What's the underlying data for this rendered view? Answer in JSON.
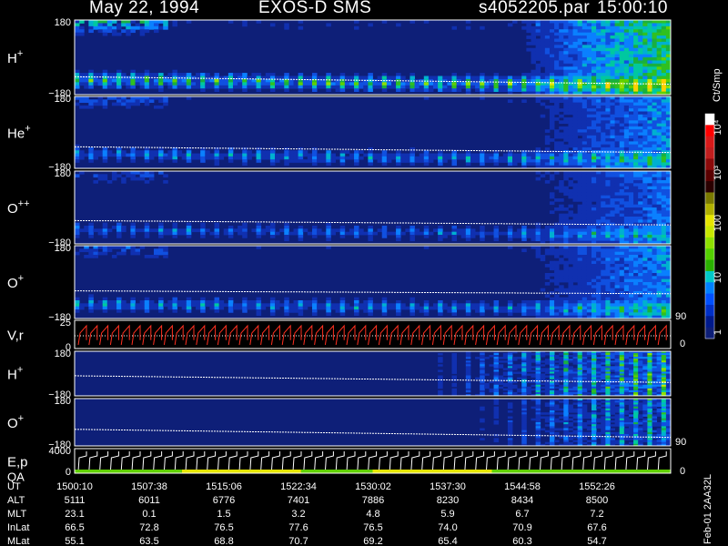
{
  "header": {
    "date": "May 22, 1994",
    "mission": "EXOS-D SMS",
    "file": "s4052205.par",
    "time": "15:00:10"
  },
  "colorbar": {
    "unit_label": "Ct/Smp",
    "tick_labels": [
      "10⁴",
      "10³",
      "100",
      "10",
      "1"
    ],
    "colors": [
      "#ffffff",
      "#ff0000",
      "#d81a1a",
      "#c01e1e",
      "#8b0a0a",
      "#5a0000",
      "#2a0000",
      "#7a7a00",
      "#b0b000",
      "#e6e600",
      "#c8e800",
      "#8ee000",
      "#54d000",
      "#2ab000",
      "#00c8c8",
      "#0080ff",
      "#0050ff",
      "#0030c8",
      "#001a8c",
      "#0e1f78"
    ]
  },
  "side_labels": {
    "colorbar_90_top": "90",
    "colorbar_0_top": "0",
    "colorbar_90_bot": "90",
    "colorbar_0_bot": "0"
  },
  "footer_id": "Feb-01 2AA32L",
  "chart_data": {
    "type": "heatmap",
    "title": "May 22, 1994   EXOS-D SMS   s4052205.par  15:00:10",
    "panels": [
      {
        "label_main": "H",
        "label_sup": "+",
        "ytop": "180",
        "ybot": "−180",
        "pattern": "ion",
        "intensity": 1.0,
        "trace": [
          0.76,
          0.86
        ],
        "late_shift": 0.0
      },
      {
        "label_main": "He",
        "label_sup": "+",
        "ytop": "180",
        "ybot": "−180",
        "pattern": "ion",
        "intensity": 0.55,
        "trace": [
          0.7,
          0.78
        ],
        "late_shift": 0.0
      },
      {
        "label_main": "O",
        "label_sup": "++",
        "ytop": "180",
        "ybot": "−180",
        "pattern": "ion",
        "intensity": 0.45,
        "trace": [
          0.68,
          0.74
        ],
        "late_shift": 0.0
      },
      {
        "label_main": "O",
        "label_sup": "+",
        "ytop": "180",
        "ybot": "−180",
        "pattern": "ion",
        "intensity": 0.55,
        "trace": [
          0.62,
          0.66
        ],
        "late_shift": 0.0
      },
      {
        "label_main": "V,r",
        "label_sup": "",
        "ytop": "25",
        "ybot": "0",
        "pattern": "sawtooth",
        "intensity": 0,
        "trace": [
          0.5,
          0.5
        ],
        "late_shift": 0
      },
      {
        "label_main": "H",
        "label_sup": "+",
        "ytop": "180",
        "ybot": "−180",
        "pattern": "late",
        "intensity": 0.7,
        "trace": [
          0.55,
          0.7
        ],
        "late_shift": 0.55
      },
      {
        "label_main": "O",
        "label_sup": "+",
        "ytop": "180",
        "ybot": "−180",
        "pattern": "late",
        "intensity": 0.6,
        "trace": [
          0.65,
          0.82
        ],
        "late_shift": 0.62
      },
      {
        "label_main": "E,p",
        "label_sup": "",
        "ytop": "4000",
        "ybot": "0",
        "pattern": "ep",
        "intensity": 0,
        "trace": [
          0.5,
          0.5
        ],
        "late_shift": 0,
        "label2": "QA"
      }
    ],
    "time_axis": {
      "row_labels": [
        "UT",
        "ALT",
        "MLT",
        "InLat",
        "MLat"
      ],
      "columns": [
        {
          "UT": "1500:10",
          "ALT": "5111",
          "MLT": "23.1",
          "InLat": "66.5",
          "MLat": "55.1"
        },
        {
          "UT": "1507:38",
          "ALT": "6011",
          "MLT": "0.1",
          "InLat": "72.8",
          "MLat": "63.5"
        },
        {
          "UT": "1515:06",
          "ALT": "6776",
          "MLT": "1.5",
          "InLat": "76.5",
          "MLat": "68.8"
        },
        {
          "UT": "1522:34",
          "ALT": "7401",
          "MLT": "3.2",
          "InLat": "77.6",
          "MLat": "70.7"
        },
        {
          "UT": "1530:02",
          "ALT": "7886",
          "MLT": "4.8",
          "InLat": "76.5",
          "MLat": "69.2"
        },
        {
          "UT": "1537:30",
          "ALT": "8230",
          "MLT": "5.9",
          "InLat": "74.0",
          "MLat": "65.4"
        },
        {
          "UT": "1544:58",
          "ALT": "8434",
          "MLT": "6.7",
          "InLat": "70.9",
          "MLat": "60.3"
        },
        {
          "UT": "1552:26",
          "ALT": "8500",
          "MLT": "7.2",
          "InLat": "67.6",
          "MLat": "54.7"
        }
      ]
    }
  }
}
